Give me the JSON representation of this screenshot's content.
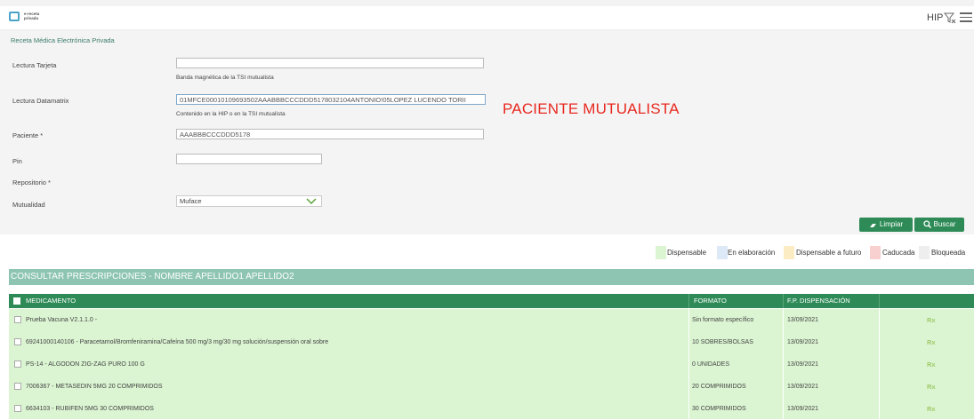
{
  "header": {
    "logo_line1": "e-receta",
    "logo_line2": "privada",
    "hip_label": "HIP"
  },
  "breadcrumb": "Receta Médica Electrónica Privada",
  "form": {
    "lectura_tarjeta_label": "Lectura Tarjeta",
    "lectura_tarjeta_value": "",
    "lectura_tarjeta_hint": "Banda magnética de la TSI mutualista",
    "lectura_datamatrix_label": "Lectura Datamatrix",
    "lectura_datamatrix_value": "01MFCE00010109693502AAABBBCCCDDD5178032104ANTONIO!05LOPEZ LUCENDO TORII",
    "lectura_datamatrix_hint": "Contenido en la HIP o en la TSI mutualista",
    "paciente_label": "Paciente *",
    "paciente_value": "AAABBBCCCDDD5178",
    "paciente_note": "PACIENTE MUTUALISTA",
    "pin_label": "Pin",
    "pin_value": "",
    "repositorio_label": "Repositorio *",
    "mutualidad_label": "Mutualidad",
    "mutualidad_value": "Muface",
    "limpiar_label": "Limpiar",
    "buscar_label": "Buscar"
  },
  "legend": [
    {
      "label": "Dispensable",
      "color": "#dbf5d2"
    },
    {
      "label": "En elaboración",
      "color": "#dde9f7"
    },
    {
      "label": "Dispensable a futuro",
      "color": "#fbecc4"
    },
    {
      "label": "Caducada",
      "color": "#f8d0d0"
    },
    {
      "label": "Bloqueada",
      "color": "#eeeeee"
    }
  ],
  "section_title": "CONSULTAR PRESCRIPCIONES - NOMBRE APELLIDO1 APELLIDO2",
  "table": {
    "columns": [
      "MEDICAMENTO",
      "FORMATO",
      "F.P. DISPENSACIÓN"
    ],
    "rows": [
      {
        "medicamento": "Prueba Vacuna V2.1.1.0 -",
        "formato": "Sin formato específico",
        "fecha": "13/09/2021",
        "rx": "Rx"
      },
      {
        "medicamento": "69241000140106 - Paracetamol/Bromfeniramina/Cafeína 500 mg/3 mg/30 mg solución/suspensión oral sobre",
        "formato": "10 SOBRES/BOLSAS",
        "fecha": "13/09/2021",
        "rx": "Rx"
      },
      {
        "medicamento": "PS-14 - ALGODON ZIG-ZAG PURO 100 G",
        "formato": "0 UNIDADES",
        "fecha": "13/09/2021",
        "rx": "Rx"
      },
      {
        "medicamento": "7006367 - METASEDIN 5MG 20 COMPRIMIDOS",
        "formato": "20 COMPRIMIDOS",
        "fecha": "13/09/2021",
        "rx": "Rx"
      },
      {
        "medicamento": "6634103 - RUBIFEN 5MG 30 COMPRIMIDOS",
        "formato": "30 COMPRIMIDOS",
        "fecha": "13/09/2021",
        "rx": "Rx"
      }
    ]
  },
  "colors": {
    "primary_green": "#2e8b57",
    "section_green": "#8ec5b2",
    "row_green": "#dbf5d2",
    "alert_red": "#e8281f"
  }
}
